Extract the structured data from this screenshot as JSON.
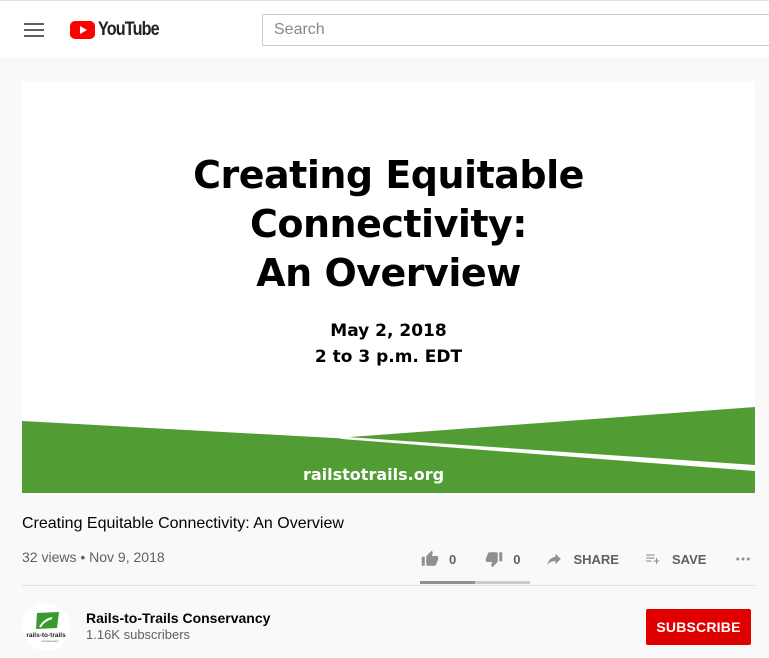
{
  "header": {
    "logo_text": "YouTube",
    "search_placeholder": "Search"
  },
  "slide": {
    "title_line1": "Creating Equitable",
    "title_line2": "Connectivity:",
    "title_line3": "An Overview",
    "date": "May 2, 2018",
    "time": "2 to 3 p.m. EDT",
    "url": "railstotrails.org",
    "accent_color": "#529c34"
  },
  "video": {
    "title": "Creating Equitable Connectivity: An Overview",
    "meta": "32 views • Nov 9, 2018",
    "likes": "0",
    "dislikes": "0",
    "share_label": "SHARE",
    "save_label": "SAVE",
    "like_ratio": 0.5
  },
  "channel": {
    "name": "Rails-to-Trails Conservancy",
    "subscribers": "1.16K subscribers",
    "avatar_text": "rails-to-trails",
    "avatar_subtext": "conservancy",
    "subscribe_label": "SUBSCRIBE",
    "subscribe_color": "#e00000"
  }
}
